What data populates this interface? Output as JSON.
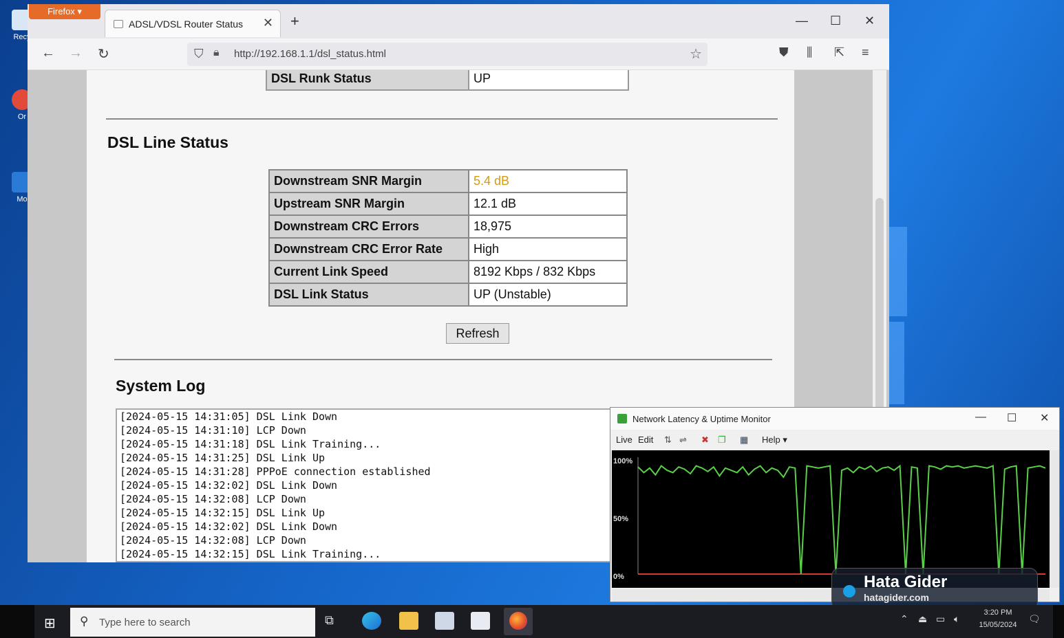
{
  "desktop": {
    "icons": [
      {
        "label": "Recy"
      },
      {
        "label": "Or"
      },
      {
        "label": "Mo"
      }
    ]
  },
  "browser": {
    "menu_label": "Firefox ▾",
    "tab_title": "ADSL/VDSL Router Status",
    "url": "http://192.168.1.1/dsl_status.html"
  },
  "page": {
    "prev_row": {
      "key": "DSL Runk Status",
      "value": "UP"
    },
    "line_status_heading": "DSL Line Status",
    "rows": [
      {
        "key": "Downstream SNR Margin",
        "value": "5.4 dB",
        "warn": true
      },
      {
        "key": "Upstream SNR Margin",
        "value": "12.1 dB"
      },
      {
        "key": "Downstream CRC Errors",
        "value": "18,975"
      },
      {
        "key": "Downstream CRC Error Rate",
        "value": "High"
      },
      {
        "key": "Current Link Speed",
        "value": "8192 Kbps / 832 Kbps"
      },
      {
        "key": "DSL Link Status",
        "value": "UP (Unstable)"
      }
    ],
    "refresh_label": "Refresh",
    "system_log_heading": "System Log",
    "log": [
      "[2024-05-15 14:31:05] DSL Link Down",
      "[2024-05-15 14:31:10] LCP Down",
      "[2024-05-15 14:31:18] DSL Link Training...",
      "[2024-05-15 14:31:25] DSL Link Up",
      "[2024-05-15 14:31:28] PPPoE connection established",
      "[2024-05-15 14:32:02] DSL Link Down",
      "[2024-05-15 14:32:08] LCP Down",
      "[2024-05-15 14:32:15] DSL Link Up",
      "[2024-05-15 14:32:02] DSL Link Down",
      "[2024-05-15 14:32:08] LCP Down",
      "[2024-05-15 14:32:15] DSL Link Training..."
    ]
  },
  "monitor": {
    "title": "Network Latency & Uptime Monitor",
    "menu": [
      "Live",
      "Edit",
      "Help ▾"
    ],
    "y_labels": [
      "100%",
      "50%",
      "0%"
    ],
    "uptime_series": [
      95,
      90,
      94,
      88,
      96,
      92,
      90,
      95,
      93,
      89,
      96,
      94,
      91,
      95,
      87,
      94,
      92,
      90,
      95,
      88,
      93,
      96,
      90,
      94,
      92,
      86,
      95,
      94,
      0,
      96,
      95,
      94,
      95,
      96,
      0,
      92,
      94,
      90,
      95,
      93,
      96,
      91,
      94,
      95,
      92,
      96,
      0,
      95,
      94,
      0,
      96,
      95,
      93,
      96,
      95,
      96,
      94,
      95,
      96,
      95,
      94,
      96,
      0,
      93,
      95,
      96,
      0,
      94,
      95,
      96,
      94
    ]
  },
  "watermark": {
    "name": "Hata Gider",
    "site": "hatagider.com"
  },
  "taskbar": {
    "search_placeholder": "Type here to search",
    "time": "3:20 PM",
    "date": "15/05/2024"
  },
  "colors": {
    "warn": "#d49b14",
    "line_green": "#5ad048",
    "line_red": "#d23a32"
  }
}
